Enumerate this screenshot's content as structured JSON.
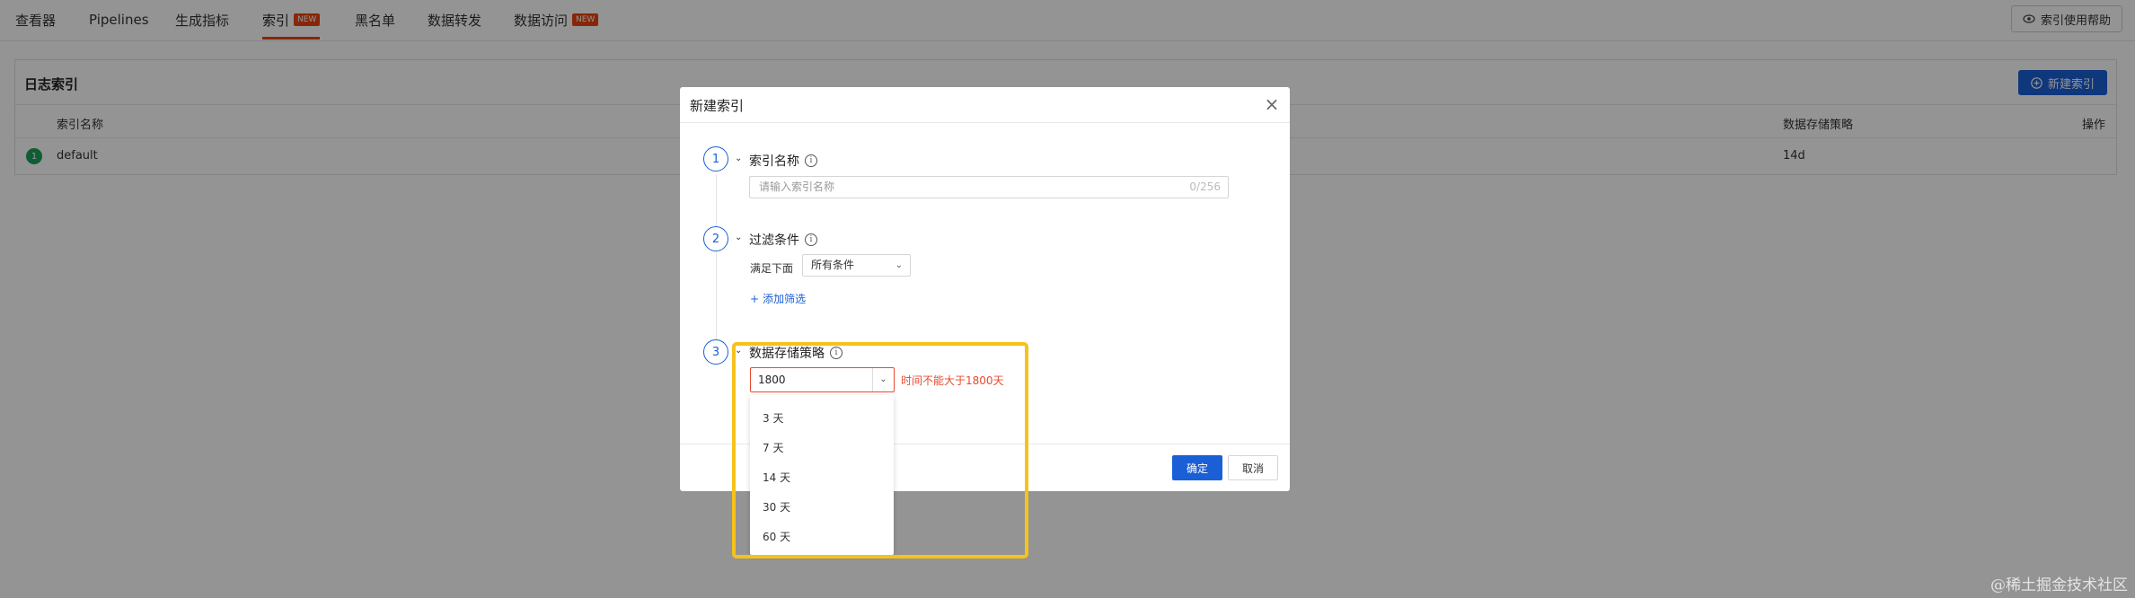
{
  "nav": {
    "tabs": [
      {
        "label": "查看器"
      },
      {
        "label": "Pipelines"
      },
      {
        "label": "生成指标"
      },
      {
        "label": "索引",
        "badge": "NEW",
        "active": true
      },
      {
        "label": "黑名单"
      },
      {
        "label": "数据转发"
      },
      {
        "label": "数据访问",
        "badge": "NEW"
      }
    ],
    "help_label": "索引使用帮助"
  },
  "page": {
    "card_title": "日志索引",
    "new_index_label": "新建索引",
    "columns": [
      "索引名称",
      "数据存储策略",
      "操作"
    ],
    "rows": [
      {
        "status": "1",
        "name": "default",
        "retention": "14d"
      }
    ]
  },
  "modal": {
    "title": "新建索引",
    "steps": [
      {
        "number": "1",
        "title": "索引名称"
      },
      {
        "number": "2",
        "title": "过滤条件"
      },
      {
        "number": "3",
        "title": "数据存储策略"
      }
    ],
    "name_placeholder": "请输入索引名称",
    "name_counter": "0/256",
    "filter_label": "满足下面",
    "filter_value": "所有条件",
    "add_filter_label": "添加筛选",
    "retention_value": "1800",
    "retention_error": "时间不能大于1800天",
    "retention_options": [
      "3 天",
      "7 天",
      "14 天",
      "30 天",
      "60 天"
    ],
    "ok_label": "确定",
    "cancel_label": "取消"
  },
  "watermark": "@稀土掘金技术社区",
  "colors": {
    "accent": "#1a5fd6",
    "tab_active": "#e8430f",
    "error": "#e84a2f",
    "highlight": "#f6c21b",
    "success": "#19a05a"
  }
}
